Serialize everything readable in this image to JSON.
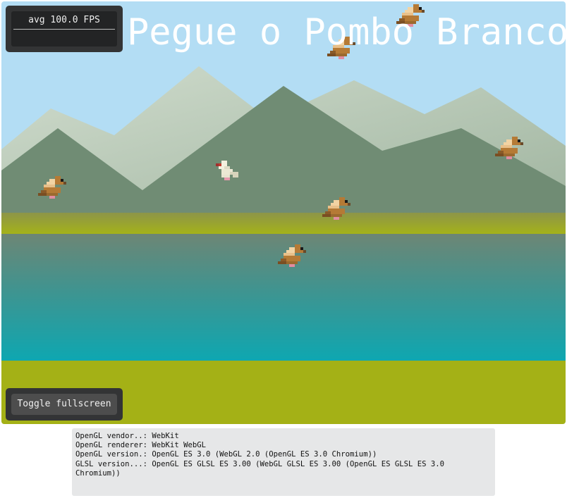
{
  "game": {
    "title": "Pegue o Pombo Branco!",
    "fps_label": "avg 100.0 FPS",
    "fullscreen_label": "Toggle fullscreen",
    "birds": [
      {
        "kind": "brown-pigeon",
        "facing": "right"
      },
      {
        "kind": "brown-pigeon",
        "facing": "right"
      },
      {
        "kind": "brown-pigeon",
        "facing": "right"
      },
      {
        "kind": "brown-pigeon",
        "facing": "right"
      },
      {
        "kind": "brown-pigeon",
        "facing": "right"
      },
      {
        "kind": "brown-pigeon",
        "facing": "right"
      },
      {
        "kind": "white-pigeon",
        "facing": "left"
      }
    ],
    "colors": {
      "sky": "#b3ddf4",
      "mountain_back": "#c4d4c3",
      "mountain_front": "#708c74",
      "grass_top": "#a4b21a",
      "water_top": "#6d8675",
      "water_bottom": "#0ea7b1",
      "grass_bottom": "#a4b116"
    }
  },
  "gl_info": {
    "lines": [
      "OpenGL vendor..: WebKit",
      "OpenGL renderer: WebKit WebGL",
      "OpenGL version.: OpenGL ES 3.0 (WebGL 2.0 (OpenGL ES 3.0 Chromium))",
      "GLSL version...: OpenGL ES GLSL ES 3.00 (WebGL GLSL ES 3.00 (OpenGL ES GLSL ES 3.0 Chromium))"
    ]
  }
}
